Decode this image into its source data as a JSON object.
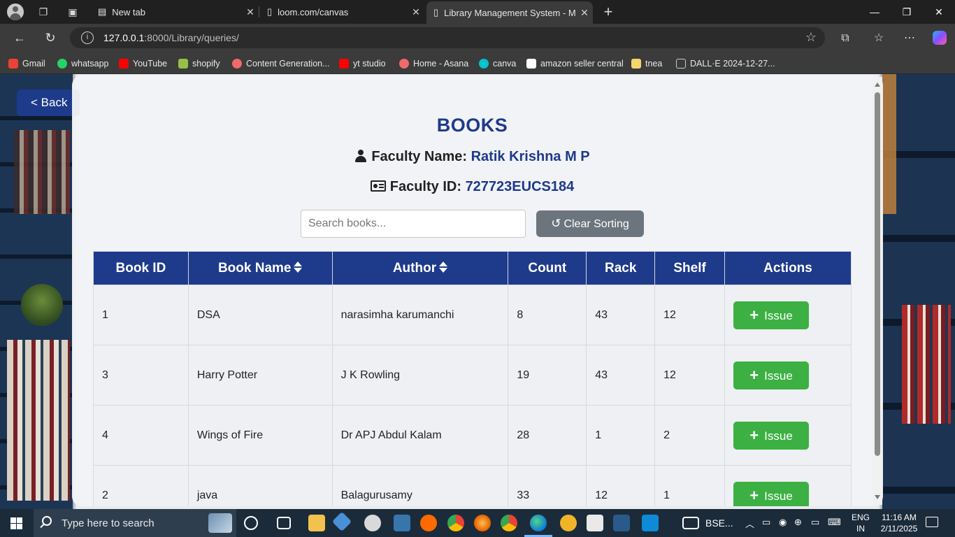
{
  "browser": {
    "tabs": [
      {
        "title": "New tab",
        "active": false
      },
      {
        "title": "loom.com/canvas",
        "active": false
      },
      {
        "title": "Library Management System - Ma",
        "active": true
      }
    ],
    "new_tab_label": "+",
    "address": {
      "host": "127.0.0.1",
      "path": ":8000/Library/queries/"
    },
    "bookmarks": [
      {
        "label": "Gmail",
        "color": "#ea4335"
      },
      {
        "label": "whatsapp",
        "color": "#25d366"
      },
      {
        "label": "YouTube",
        "color": "#ff0000"
      },
      {
        "label": "shopify",
        "color": "#95bf47"
      },
      {
        "label": "Content Generation...",
        "color": "#f06a6a"
      },
      {
        "label": "yt studio",
        "color": "#ff0000"
      },
      {
        "label": "Home - Asana",
        "color": "#f06a6a"
      },
      {
        "label": "canva",
        "color": "#00c4cc"
      },
      {
        "label": "amazon seller central",
        "color": "#ffffff"
      },
      {
        "label": "tnea",
        "color": "#f5d76e"
      },
      {
        "label": "DALL·E 2024-12-27...",
        "color": "#cccccc"
      }
    ]
  },
  "page": {
    "back_label": "< Back",
    "title": "BOOKS",
    "faculty_name_label": "Faculty Name:",
    "faculty_name": "Ratik Krishna M P",
    "faculty_id_label": "Faculty ID:",
    "faculty_id": "727723EUCS184",
    "search_placeholder": "Search books...",
    "clear_sorting_label": "Clear Sorting",
    "columns": [
      "Book ID",
      "Book Name",
      "Author",
      "Count",
      "Rack",
      "Shelf",
      "Actions"
    ],
    "issue_label": "Issue",
    "rows": [
      {
        "id": "1",
        "name": "DSA",
        "author": "narasimha karumanchi",
        "count": "8",
        "rack": "43",
        "shelf": "12"
      },
      {
        "id": "3",
        "name": "Harry Potter",
        "author": "J K Rowling",
        "count": "19",
        "rack": "43",
        "shelf": "12"
      },
      {
        "id": "4",
        "name": "Wings of Fire",
        "author": "Dr APJ Abdul Kalam",
        "count": "28",
        "rack": "1",
        "shelf": "2"
      },
      {
        "id": "2",
        "name": "java",
        "author": "Balagurusamy",
        "count": "33",
        "rack": "12",
        "shelf": "1"
      }
    ],
    "accent_color": "#1e3a8a",
    "issue_color": "#3cb043"
  },
  "taskbar": {
    "search_placeholder": "Type here to search",
    "pinned_label": "BSE...",
    "lang_top": "ENG",
    "lang_bottom": "IN",
    "time": "11:16 AM",
    "date": "2/11/2025"
  }
}
